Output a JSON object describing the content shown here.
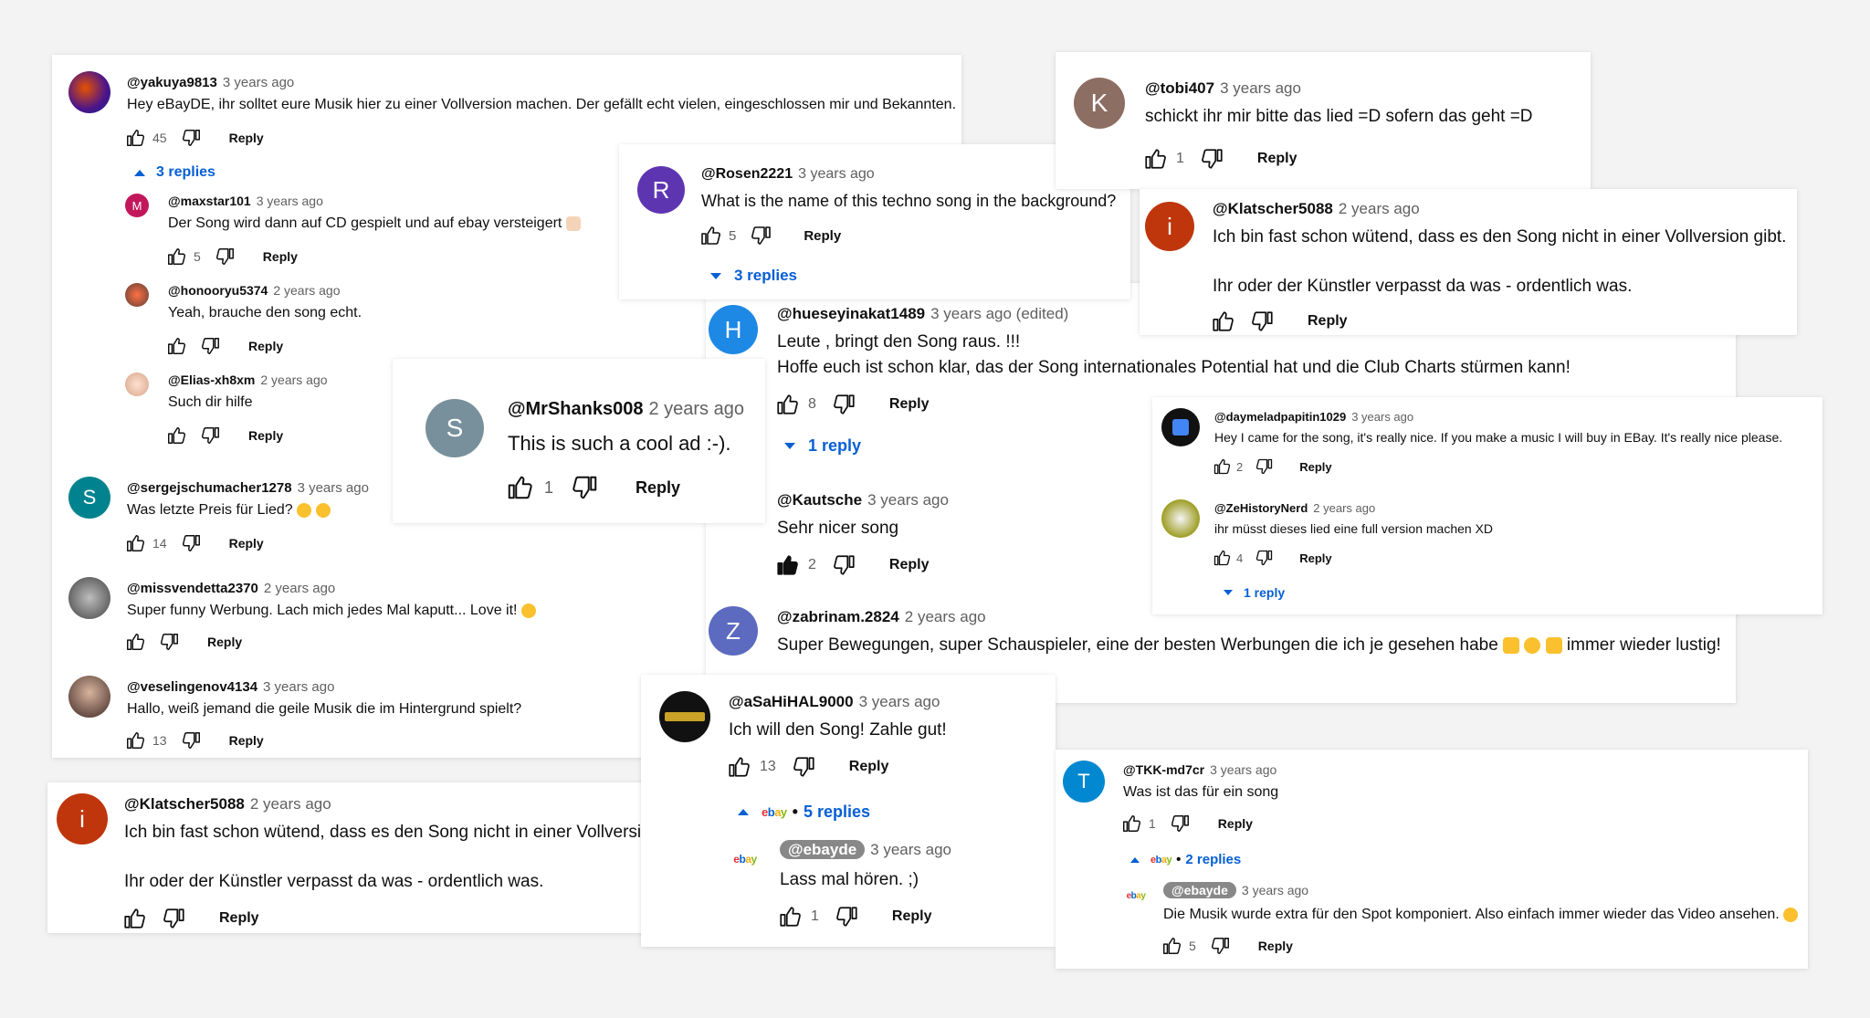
{
  "cards": {
    "c1": {
      "top": {
        "author": "@yakuya9813",
        "time": "3 years ago",
        "text": "Hey eBayDE, ihr solltet eure Musik hier zu einer Vollversion machen. Der gefällt echt vielen, eingeschlossen mir und Bekannten.",
        "likes": "45",
        "reply": "Reply",
        "replies_link": "3 replies"
      },
      "r1": {
        "avatar": "M",
        "author": "@maxstar101",
        "time": "3 years ago",
        "text": "Der Song wird dann auf CD gespielt und auf ebay versteigert",
        "likes": "5",
        "reply": "Reply"
      },
      "r2": {
        "author": "@honooryu5374",
        "time": "2 years ago",
        "text": "Yeah, brauche den song echt.",
        "likes": "",
        "reply": "Reply"
      },
      "r3": {
        "author": "@Elias-xh8xm",
        "time": "2 years ago",
        "text": "Such dir hilfe",
        "likes": "",
        "reply": "Reply"
      },
      "s1": {
        "avatar": "S",
        "author": "@sergejschumacher1278",
        "time": "3 years ago",
        "text": "Was letzte Preis für Lied?",
        "likes": "14",
        "reply": "Reply"
      },
      "s2": {
        "author": "@missvendetta2370",
        "time": "2 years ago",
        "text": "Super funny Werbung. Lach mich jedes Mal kaputt... Love it!",
        "likes": "",
        "reply": "Reply"
      },
      "s3": {
        "author": "@veselingenov4134",
        "time": "3 years ago",
        "text": "Hallo, weiß jemand die geile Musik die im Hintergrund spielt?",
        "likes": "13",
        "reply": "Reply"
      }
    },
    "c2": {
      "avatar": "R",
      "author": "@Rosen2221",
      "time": "3 years ago",
      "text": "What is the name of this techno song in the background?",
      "likes": "5",
      "reply": "Reply",
      "replies_link": "3 replies"
    },
    "c3": {
      "avatar": "K",
      "author": "@tobi407",
      "time": "3 years ago",
      "text": "schickt ihr mir bitte das lied =D  sofern das geht =D",
      "likes": "1",
      "reply": "Reply"
    },
    "c4": {
      "avatar": "i",
      "author": "@Klatscher5088",
      "time": "2 years ago",
      "text1": "Ich bin fast schon wütend, dass es den Song nicht in einer Vollversion gibt.",
      "text2": "Ihr oder der Künstler verpasst da was - ordentlich was.",
      "likes": "",
      "reply": "Reply"
    },
    "c5": {
      "top": {
        "avatar": "H",
        "author": "@hueseyinakat1489",
        "time": "3 years ago (edited)",
        "text1": "Leute , bringt den Song raus. !!!",
        "text2": "Hoffe euch ist schon klar, das der Song internationales Potential hat und die Club Charts stürmen  kann!",
        "likes": "8",
        "reply": "Reply",
        "replies_link": "1 reply"
      },
      "k": {
        "author": "@Kautsche",
        "time": "3 years ago",
        "text": "Sehr nicer song",
        "likes": "2",
        "reply": "Reply"
      },
      "z": {
        "avatar": "Z",
        "author": "@zabrinam.2824",
        "time": "2 years ago",
        "text": "Super Bewegungen, super Schauspieler, eine der besten Werbungen die ich je gesehen habe",
        "text_tail": "immer wieder lustig!"
      }
    },
    "c6": {
      "avatar": "S",
      "author": "@MrShanks008",
      "time": "2 years ago",
      "text": "This is such a cool ad :-).",
      "likes": "1",
      "reply": "Reply"
    },
    "c7": {
      "a": {
        "author": "@daymeladpapitin1029",
        "time": "3 years ago",
        "text": "Hey I came for the song, it's really nice. If you make a music I will buy in EBay. It's really nice please.",
        "likes": "2",
        "reply": "Reply"
      },
      "b": {
        "author": "@ZeHistoryNerd",
        "time": "2 years ago",
        "text": "ihr müsst dieses lied eine full version machen XD",
        "likes": "4",
        "reply": "Reply",
        "replies_link": "1 reply"
      }
    },
    "c8": {
      "top": {
        "author": "@aSaHiHAL9000",
        "time": "3 years ago",
        "text": "Ich will den Song! Zahle gut!",
        "likes": "13",
        "reply": "Reply",
        "replies_link": "5 replies"
      },
      "r": {
        "author": "@ebayde",
        "time": "3 years ago",
        "text": "Lass mal hören. ;)",
        "likes": "1",
        "reply": "Reply"
      }
    },
    "c9": {
      "avatar": "i",
      "author": "@Klatscher5088",
      "time": "2 years ago",
      "text1": "Ich bin fast schon wütend, dass es den Song nicht in einer Vollversion gibt.",
      "text2": "Ihr oder der Künstler verpasst da was - ordentlich was.",
      "likes": "",
      "reply": "Reply"
    },
    "c10": {
      "top": {
        "avatar": "T",
        "author": "@TKK-md7cr",
        "time": "3 years ago",
        "text": "Was ist das für ein song",
        "likes": "1",
        "reply": "Reply",
        "replies_link": "2 replies"
      },
      "r": {
        "author": "@ebayde",
        "time": "3 years ago",
        "text": "Die Musik wurde extra für den Spot komponiert. Also einfach immer wieder das Video ansehen.",
        "likes": "5",
        "reply": "Reply"
      }
    }
  },
  "ebay_logo": {
    "e": "e",
    "b": "b",
    "a": "a",
    "y": "y"
  },
  "colors": {
    "link": "#065fd4",
    "avatar_M": "#c2185b",
    "avatar_S": "#00838f",
    "avatar_R": "#5e35b1",
    "avatar_K": "#8d6e63",
    "avatar_i": "#bf360c",
    "avatar_H": "#1e88e5",
    "avatar_Z": "#5c6bc0",
    "avatar_S2": "#78909c",
    "avatar_T": "#0288d1"
  }
}
